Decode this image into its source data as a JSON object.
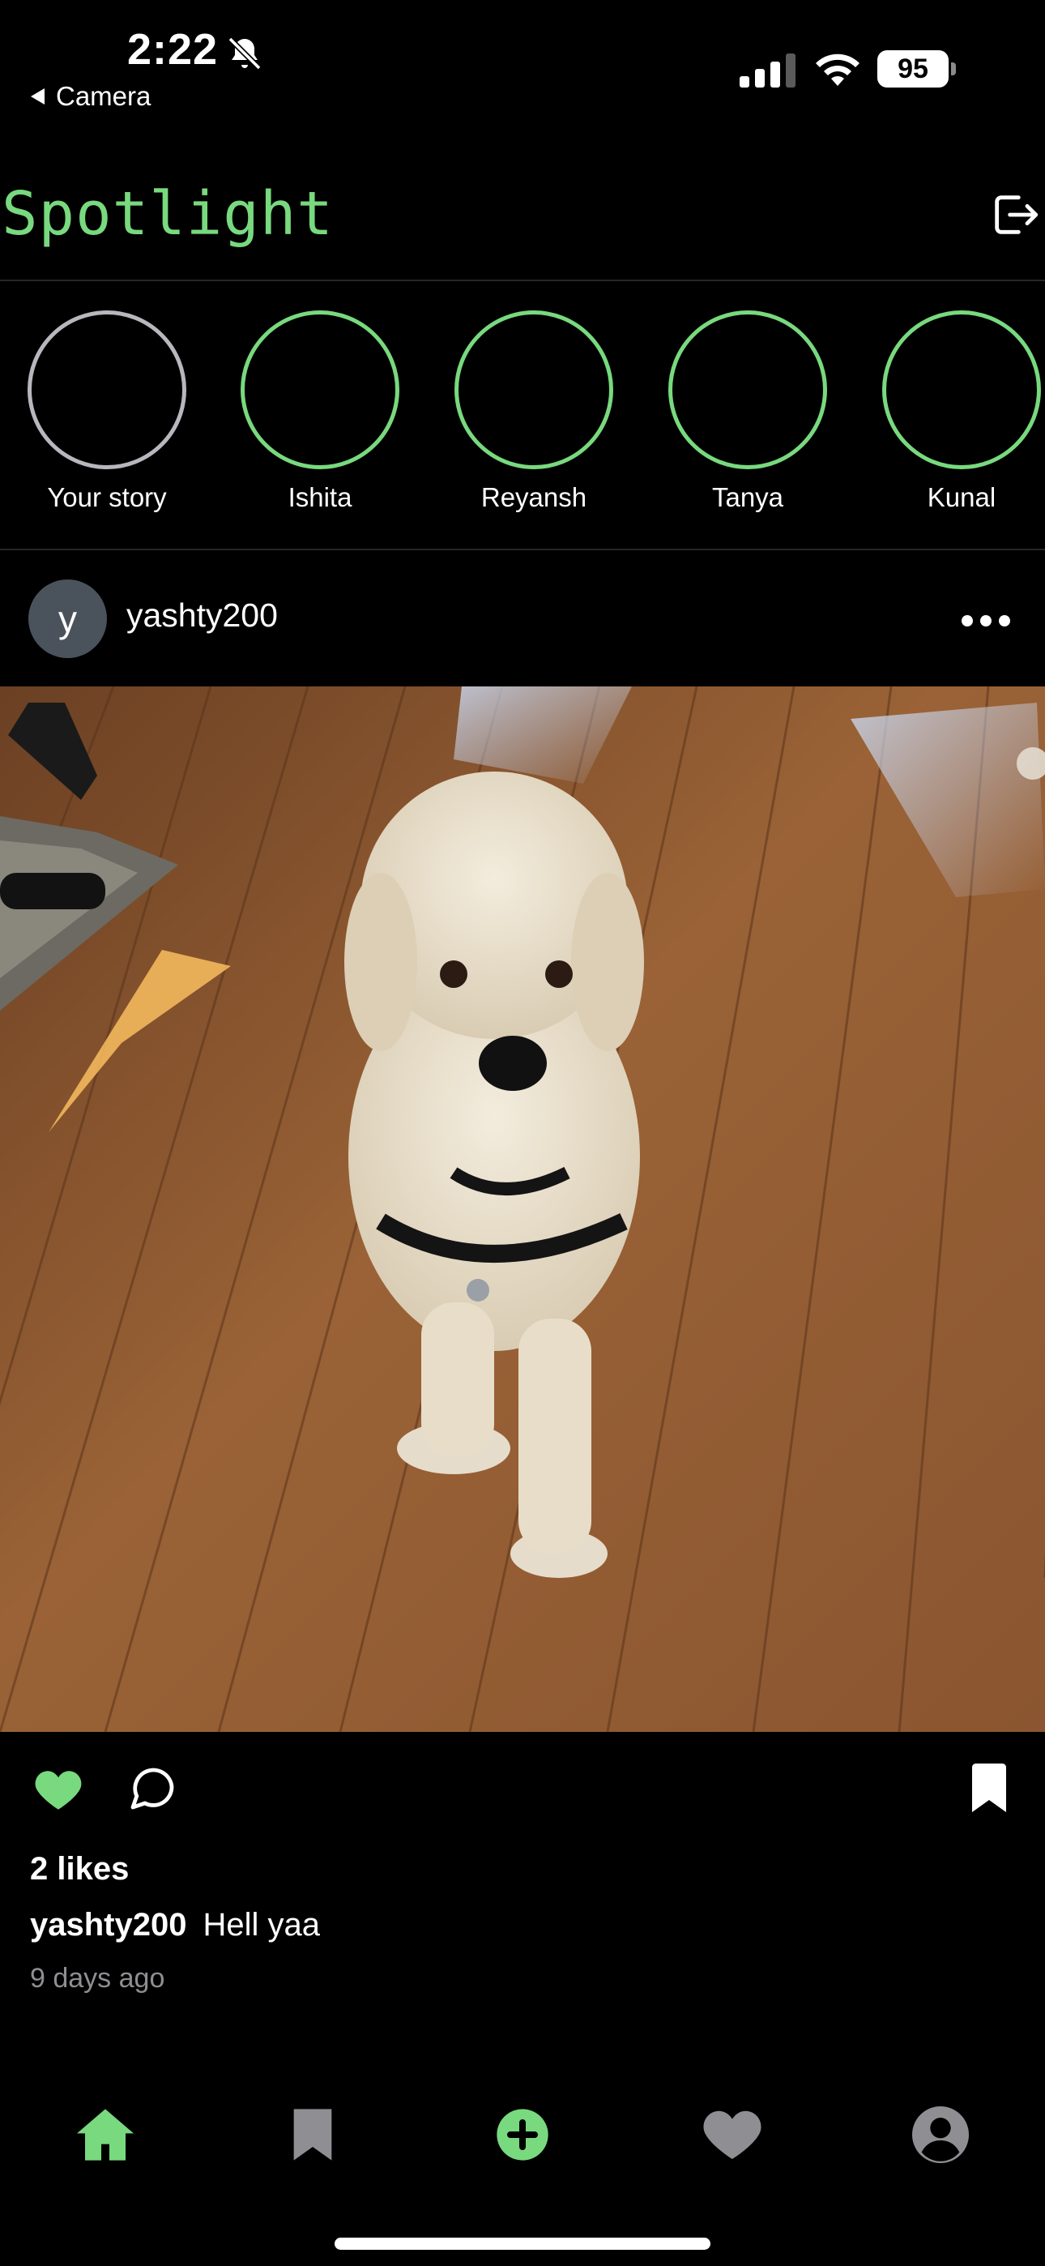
{
  "status_bar": {
    "time": "2:22",
    "back_label": "Camera",
    "battery": "95"
  },
  "header": {
    "title": "Spotlight"
  },
  "stories": [
    {
      "name": "Your story",
      "own": true
    },
    {
      "name": "Ishita",
      "own": false
    },
    {
      "name": "Reyansh",
      "own": false
    },
    {
      "name": "Tanya",
      "own": false
    },
    {
      "name": "Kunal",
      "own": false
    }
  ],
  "post": {
    "avatar_initial": "y",
    "username": "yashty200",
    "likes": "2 likes",
    "caption_user": "yashty200",
    "caption_text": "Hell yaa",
    "timestamp": "9 days ago"
  },
  "tabs": [
    {
      "icon": "home-icon",
      "active": true
    },
    {
      "icon": "bookmark-icon",
      "active": false
    },
    {
      "icon": "add-icon",
      "active": false
    },
    {
      "icon": "heart-icon",
      "active": false
    },
    {
      "icon": "profile-icon",
      "active": false
    }
  ],
  "colors": {
    "accent": "#78d97e",
    "background": "#000000",
    "muted": "#8e8e93",
    "inactive_tab": "#8e8e93"
  }
}
